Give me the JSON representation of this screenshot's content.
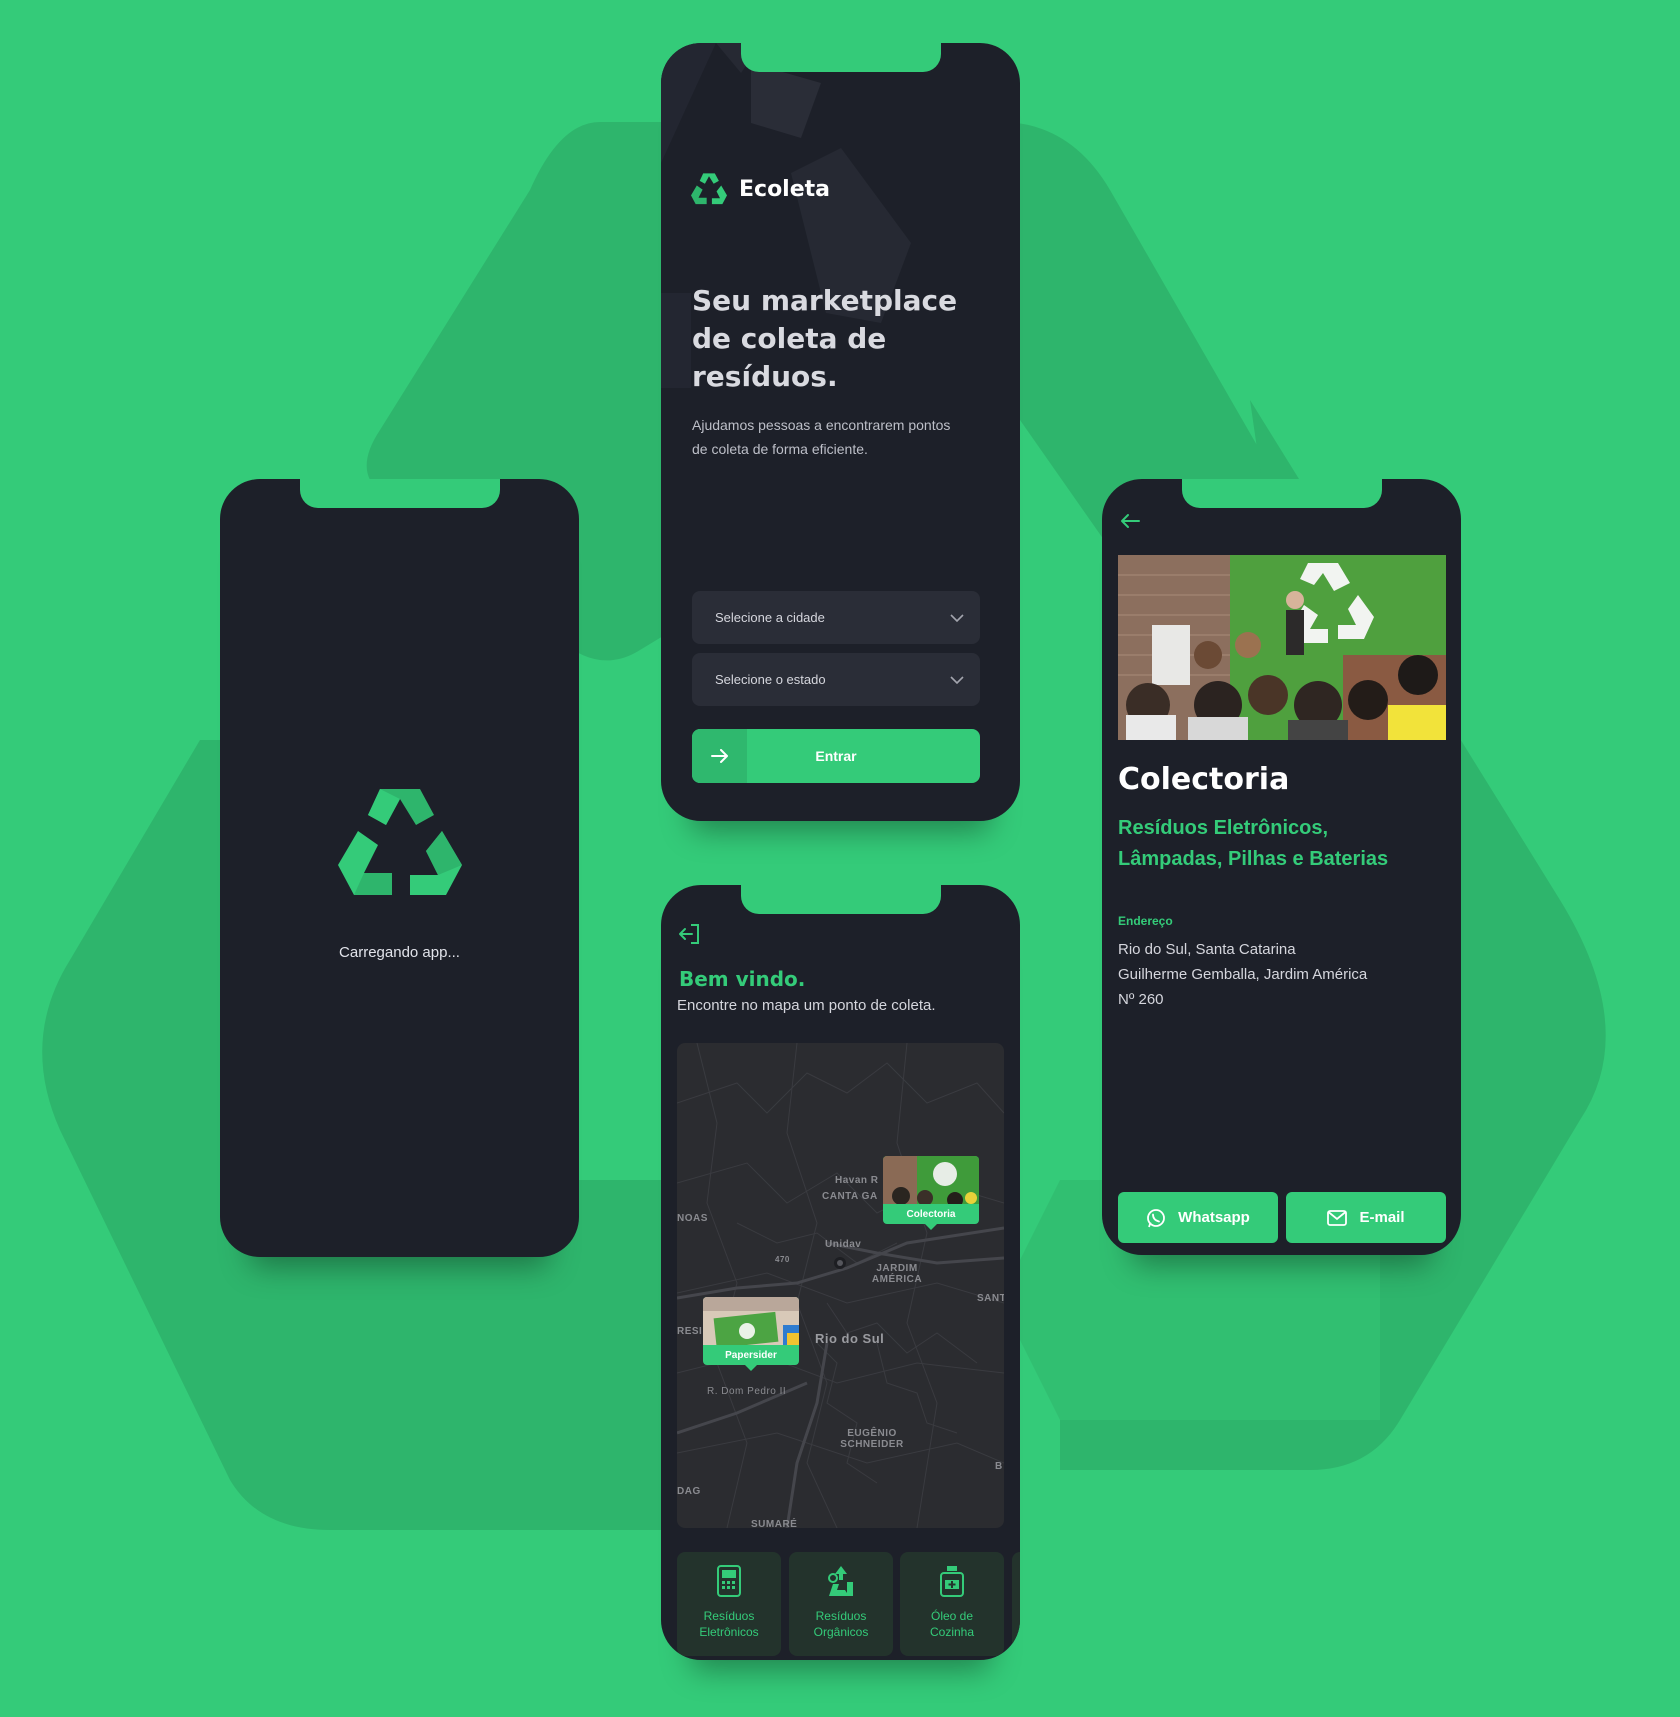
{
  "colors": {
    "brand": "#34CB79",
    "phone_bg": "#1D2029",
    "select_bg": "#2A2D37"
  },
  "loading": {
    "text": "Carregando app..."
  },
  "home": {
    "brand_name": "Ecoleta",
    "headline": "Seu marketplace de coleta de resíduos.",
    "subtext": "Ajudamos pessoas a encontrarem pontos de coleta de forma eficiente.",
    "select_city": "Selecione a cidade",
    "select_state": "Selecione o estado",
    "enter_button": "Entrar"
  },
  "map_screen": {
    "welcome": "Bem vindo.",
    "subtitle": "Encontre no mapa um ponto de coleta.",
    "map_labels": [
      "Havan R",
      "CANTA GA",
      "NOAS",
      "Unidav",
      "JARDIM AMÉRICA",
      "SANT",
      "RESI",
      "Rio do Sul",
      "R. Dom Pedro II",
      "EUGÊNIO SCHNEIDER",
      "DAG",
      "SUMARÉ",
      "B",
      "470"
    ],
    "markers": [
      {
        "name": "Colectoria"
      },
      {
        "name": "Papersider"
      }
    ],
    "categories": [
      {
        "label": "Resíduos Eletrônicos",
        "icon": "battery-icon"
      },
      {
        "label": "Resíduos Orgânicos",
        "icon": "compost-icon"
      },
      {
        "label": "Óleo de Cozinha",
        "icon": "oil-bottle-icon"
      }
    ]
  },
  "detail": {
    "name": "Colectoria",
    "items": "Resíduos Eletrônicos, Lâmpadas, Pilhas e Baterias",
    "address_label": "Endereço",
    "address_line1": "Rio do Sul, Santa Catarina",
    "address_line2": "Guilherme Gemballa, Jardim América",
    "address_line3": "Nº 260",
    "whatsapp_button": "Whatsapp",
    "email_button": "E-mail"
  }
}
